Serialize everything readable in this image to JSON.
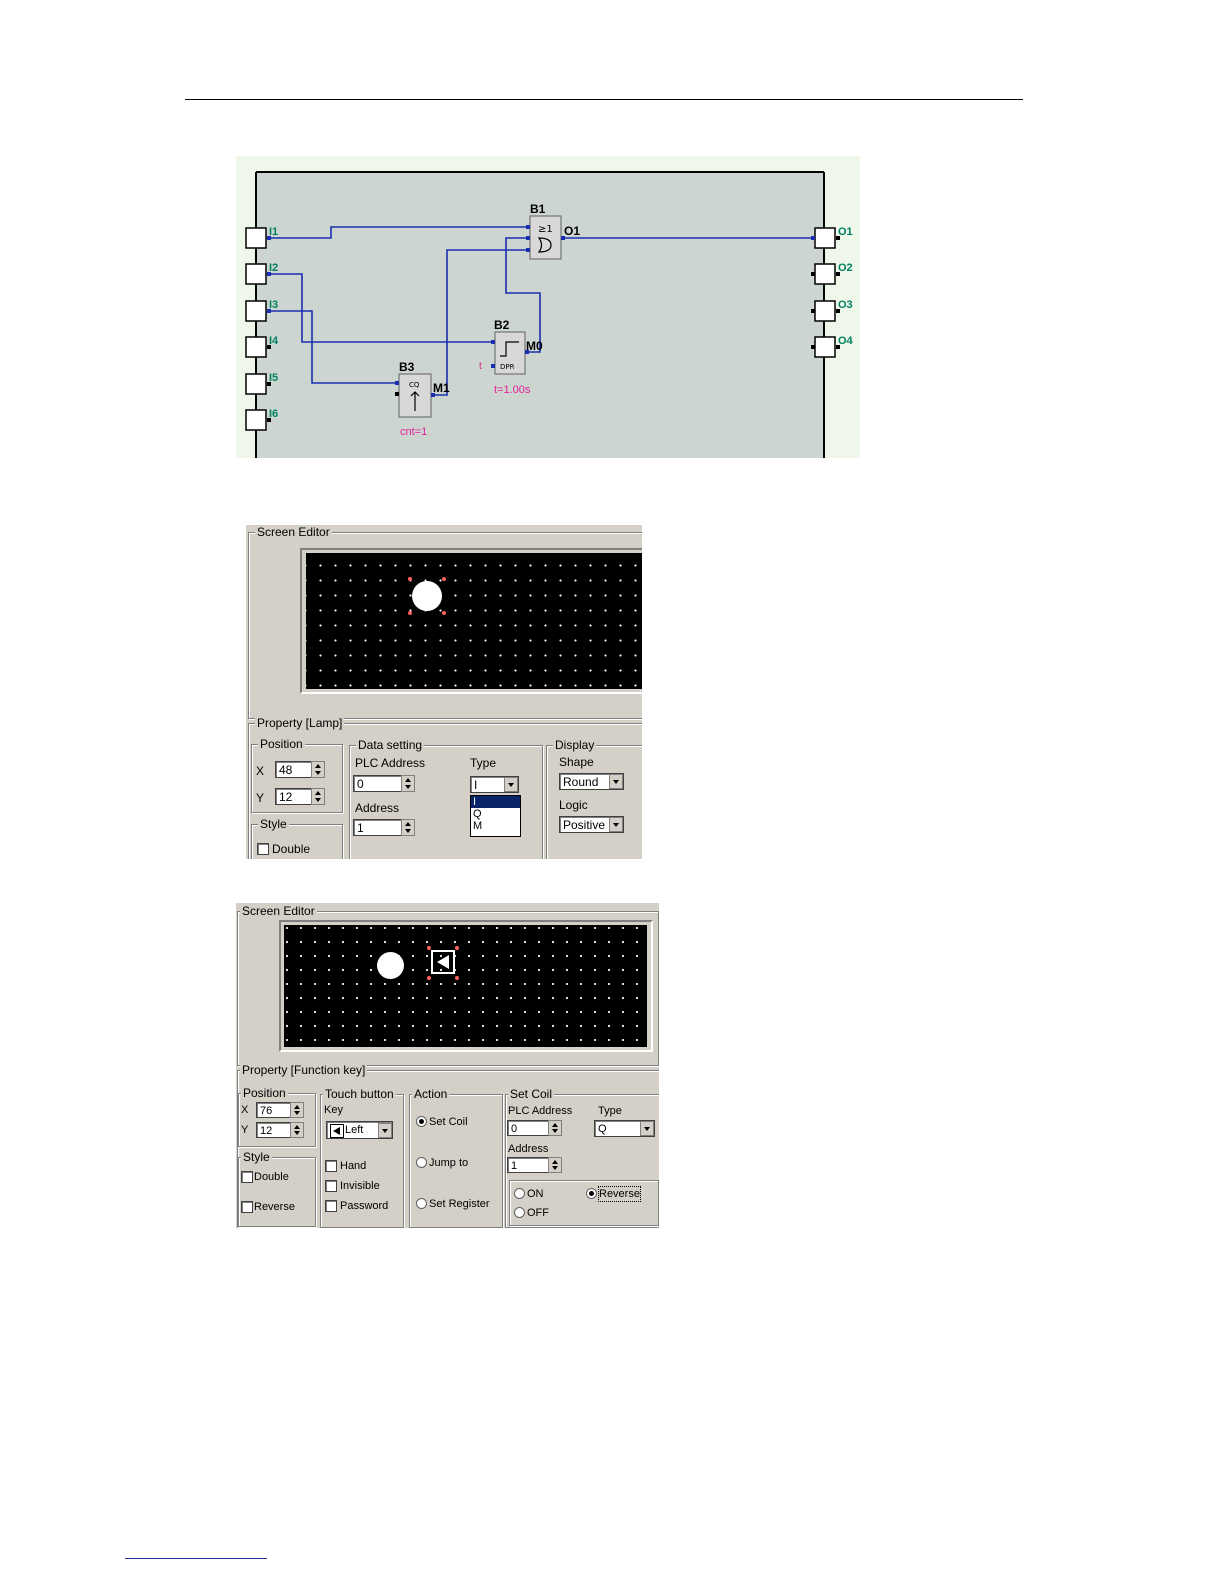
{
  "fbd": {
    "inputs": [
      "I1",
      "I2",
      "I3",
      "I4",
      "I5",
      "I6"
    ],
    "outputs": [
      "O1",
      "O2",
      "O3",
      "O4"
    ],
    "blocks": {
      "b1": {
        "name": "B1",
        "symbol_top": "≥1",
        "out": "O1"
      },
      "b2": {
        "name": "B2",
        "symbol": "DPR",
        "in_label": "t",
        "out": "M0",
        "param": "t=1.00s"
      },
      "b3": {
        "name": "B3",
        "symbol": "CQ",
        "out": "M1",
        "param": "cnt=1"
      }
    },
    "colors": {
      "wire": "#1a2eb0",
      "label": "#008060",
      "param": "#e0209a",
      "bg": "#cdd5d1",
      "outer": "#eef7e9"
    }
  },
  "lamp_dialog": {
    "screen_editor_title": "Screen Editor",
    "property_title": "Property  [Lamp]",
    "position": {
      "title": "Position",
      "x_label": "X",
      "x_value": "48",
      "y_label": "Y",
      "y_value": "12"
    },
    "style": {
      "title": "Style",
      "double_label": "Double"
    },
    "data_setting": {
      "title": "Data setting",
      "plc_address_label": "PLC Address",
      "plc_address_value": "0",
      "type_label": "Type",
      "type_value": "I",
      "type_options": [
        "I",
        "Q",
        "M"
      ],
      "address_label": "Address",
      "address_value": "1"
    },
    "display": {
      "title": "Display",
      "shape_label": "Shape",
      "shape_value": "Round",
      "logic_label": "Logic",
      "logic_value": "Positive"
    }
  },
  "fkey_dialog": {
    "screen_editor_title": "Screen Editor",
    "property_title": "Property  [Function key]",
    "position": {
      "title": "Position",
      "x_label": "X",
      "x_value": "76",
      "y_label": "Y",
      "y_value": "12"
    },
    "style": {
      "title": "Style",
      "double_label": "Double",
      "reverse_label": "Reverse"
    },
    "touch_button": {
      "title": "Touch button",
      "key_label": "Key",
      "key_value": "Left",
      "hand_label": "Hand",
      "invisible_label": "Invisible",
      "password_label": "Password"
    },
    "action": {
      "title": "Action",
      "set_coil_label": "Set Coil",
      "jump_to_label": "Jump to",
      "set_register_label": "Set Register",
      "selected": "Set Coil"
    },
    "set_coil": {
      "title": "Set Coil",
      "plc_address_label": "PLC Address",
      "plc_address_value": "0",
      "type_label": "Type",
      "type_value": "Q",
      "address_label": "Address",
      "address_value": "1",
      "on_label": "ON",
      "off_label": "OFF",
      "reverse_label": "Reverse",
      "selected": "Reverse"
    }
  }
}
